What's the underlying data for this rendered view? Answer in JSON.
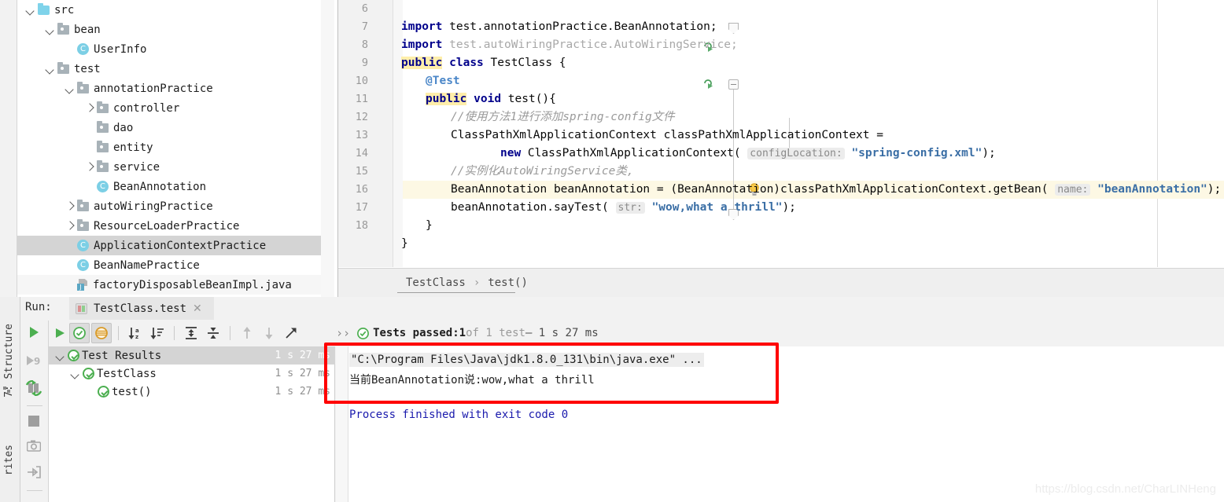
{
  "project_tree": {
    "items": [
      {
        "label": "src",
        "indent": 0,
        "twisty": "down",
        "icon": "folder-source-icon",
        "selected": false
      },
      {
        "label": "bean",
        "indent": 1,
        "twisty": "down",
        "icon": "folder-package-icon",
        "selected": false
      },
      {
        "label": "UserInfo",
        "indent": 2,
        "twisty": "none",
        "icon": "java-class-icon",
        "selected": false
      },
      {
        "label": "test",
        "indent": 1,
        "twisty": "down",
        "icon": "folder-package-icon",
        "selected": false
      },
      {
        "label": "annotationPractice",
        "indent": 2,
        "twisty": "down",
        "icon": "folder-package-icon",
        "selected": false
      },
      {
        "label": "controller",
        "indent": 3,
        "twisty": "right",
        "icon": "folder-package-icon",
        "selected": false
      },
      {
        "label": "dao",
        "indent": 3,
        "twisty": "none",
        "icon": "folder-package-icon",
        "selected": false
      },
      {
        "label": "entity",
        "indent": 3,
        "twisty": "none",
        "icon": "folder-package-icon",
        "selected": false
      },
      {
        "label": "service",
        "indent": 3,
        "twisty": "right",
        "icon": "folder-package-icon",
        "selected": false
      },
      {
        "label": "BeanAnnotation",
        "indent": 3,
        "twisty": "none",
        "icon": "java-class-icon",
        "selected": false
      },
      {
        "label": "autoWiringPractice",
        "indent": 2,
        "twisty": "right",
        "icon": "folder-package-icon",
        "selected": false
      },
      {
        "label": "ResourceLoaderPractice",
        "indent": 2,
        "twisty": "right",
        "icon": "folder-package-icon",
        "selected": false
      },
      {
        "label": "ApplicationContextPractice",
        "indent": 2,
        "twisty": "none",
        "icon": "java-class-icon",
        "selected": true
      },
      {
        "label": "BeanNamePractice",
        "indent": 2,
        "twisty": "none",
        "icon": "java-class-icon",
        "selected": false
      },
      {
        "label": "factoryDisposableBeanImpl.java",
        "indent": 2,
        "twisty": "none",
        "icon": "java-file-icon",
        "selected": false
      }
    ]
  },
  "editor": {
    "lines": [
      {
        "num": "6",
        "highlight": false
      },
      {
        "num": "7",
        "highlight": false
      },
      {
        "num": "8",
        "highlight": false
      },
      {
        "num": "9",
        "highlight": false
      },
      {
        "num": "10",
        "highlight": false
      },
      {
        "num": "11",
        "highlight": false
      },
      {
        "num": "12",
        "highlight": false
      },
      {
        "num": "13",
        "highlight": false
      },
      {
        "num": "14",
        "highlight": false
      },
      {
        "num": "15",
        "highlight": false
      },
      {
        "num": "16",
        "highlight": true
      },
      {
        "num": "17",
        "highlight": false
      },
      {
        "num": "18",
        "highlight": false
      }
    ],
    "code": {
      "l6_kw": "import",
      "l6_rest": " test.annotationPractice.BeanAnnotation;",
      "l7_kw": "import",
      "l7_rest": " test.autoWiringPractice.AutoWiringService;",
      "l8_public": "public",
      "l8_class": "class",
      "l8_name": " TestClass {",
      "l9_anno": "@Test",
      "l10_public": "public",
      "l10_void": "void",
      "l10_rest": " test(){",
      "l11_comment": "//使用方法1进行添加spring-config文件",
      "l12_text": "ClassPathXmlApplicationContext classPathXmlApplicationContext =",
      "l13_new": "new",
      "l13_call": " ClassPathXmlApplicationContext(",
      "l13_hint": "configLocation:",
      "l13_str": "\"spring-config.xml\"",
      "l13_tail": ");",
      "l14_comment": "//实例化AutoWiringService类,",
      "l15_text": "BeanAnnotation beanAnnotation = (BeanAnnotation)classPathXmlApplicationContext.getBean(",
      "l15_hint": "name:",
      "l15_str": "\"beanAnnotation\"",
      "l15_tail": ");",
      "l16_text": "beanAnnotation.sayTest(",
      "l16_hint": "str:",
      "l16_str": "\"wow,what a thrill\"",
      "l16_tail": ");",
      "l17_text": "}",
      "l18_text": "}"
    }
  },
  "breadcrumb": {
    "class": "TestClass",
    "separator": "›",
    "method": "test()"
  },
  "run_window": {
    "run_label": "Run:",
    "tab_name": "TestClass.test",
    "tab_close": "✕",
    "toolbar": {
      "rerun": "rerun-icon",
      "toggle_passed": "show-passed-icon",
      "toggle_ignored": "show-ignored-icon",
      "sort_alpha": "sort-alphabetically-icon",
      "sort_duration": "sort-by-duration-icon",
      "expand_all": "expand-all-icon",
      "collapse_all": "collapse-all-icon",
      "prev_failed": "previous-failed-icon",
      "next_failed": "next-failed-icon",
      "export": "export-icon",
      "more": "››"
    },
    "status": {
      "chevron": "››",
      "prefix": "Tests passed: ",
      "count": "1",
      "of_text": " of 1 test",
      "duration": " – 1 s 27 ms"
    },
    "test_tree": [
      {
        "label": "Test Results",
        "time": "1 s 27 ms",
        "indent": 0,
        "twisty": "down",
        "selected": true
      },
      {
        "label": "TestClass",
        "time": "1 s 27 ms",
        "indent": 1,
        "twisty": "down",
        "selected": false
      },
      {
        "label": "test()",
        "time": "1 s 27 ms",
        "indent": 2,
        "twisty": "none",
        "selected": false
      }
    ],
    "console": {
      "command": "\"C:\\Program Files\\Java\\jdk1.8.0_131\\bin\\java.exe\" ...",
      "output": "当前BeanAnnotation说:wow,what a thrill",
      "exit": "Process finished with exit code 0"
    }
  },
  "left_strip": {
    "structure_label": "7: Structure",
    "favorites_label": "rites",
    "icons": [
      "run-icon",
      "debug-icon",
      "rerun-tests-icon",
      "stop-icon",
      "camera-icon",
      "export-to-file-icon",
      "layout-icon"
    ]
  },
  "watermark": "https://blog.csdn.net/CharLINHeng",
  "colors": {
    "accent_green": "#4caf50",
    "keyword_blue": "#00008b",
    "string_blue": "#3a6ea5",
    "annotation_blue": "#4a86c8",
    "highlight_yellow": "#ffeeaa",
    "current_line": "#fdf8e4",
    "selection_gray": "#d4d4d4",
    "red_box": "#ff0000",
    "panel_bg": "#f2f2f2",
    "class_icon_cyan": "#7ccfe5"
  }
}
